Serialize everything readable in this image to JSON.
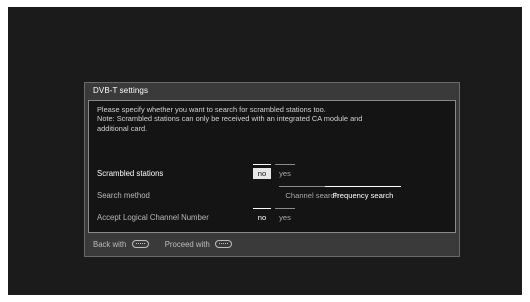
{
  "dialog": {
    "title": "DVB-T settings",
    "description": [
      "Please specify whether you want to search for scrambled stations too.",
      "Note: Scrambled stations can only be received with an integrated CA module and",
      "additional card."
    ]
  },
  "rows": [
    {
      "label": "Scrambled stations",
      "active": true,
      "options": [
        "no",
        "yes"
      ],
      "selected": "no"
    },
    {
      "label": "Search method",
      "active": false,
      "options": [
        "Channel search",
        "Frequency search"
      ],
      "selected": "Frequency search"
    },
    {
      "label": "Accept Logical Channel Number",
      "active": false,
      "options": [
        "no",
        "yes"
      ],
      "selected": "no"
    }
  ],
  "footer": {
    "back_label": "Back with",
    "back_icon": "back-key-icon",
    "proceed_label": "Proceed with",
    "proceed_icon": "ok-key-icon"
  },
  "colors": {
    "screen_bg": "#1b1b1b",
    "dialog_bg": "#3a3a3a",
    "content_bg": "#141414",
    "highlight_bg": "#e6e6e6"
  }
}
